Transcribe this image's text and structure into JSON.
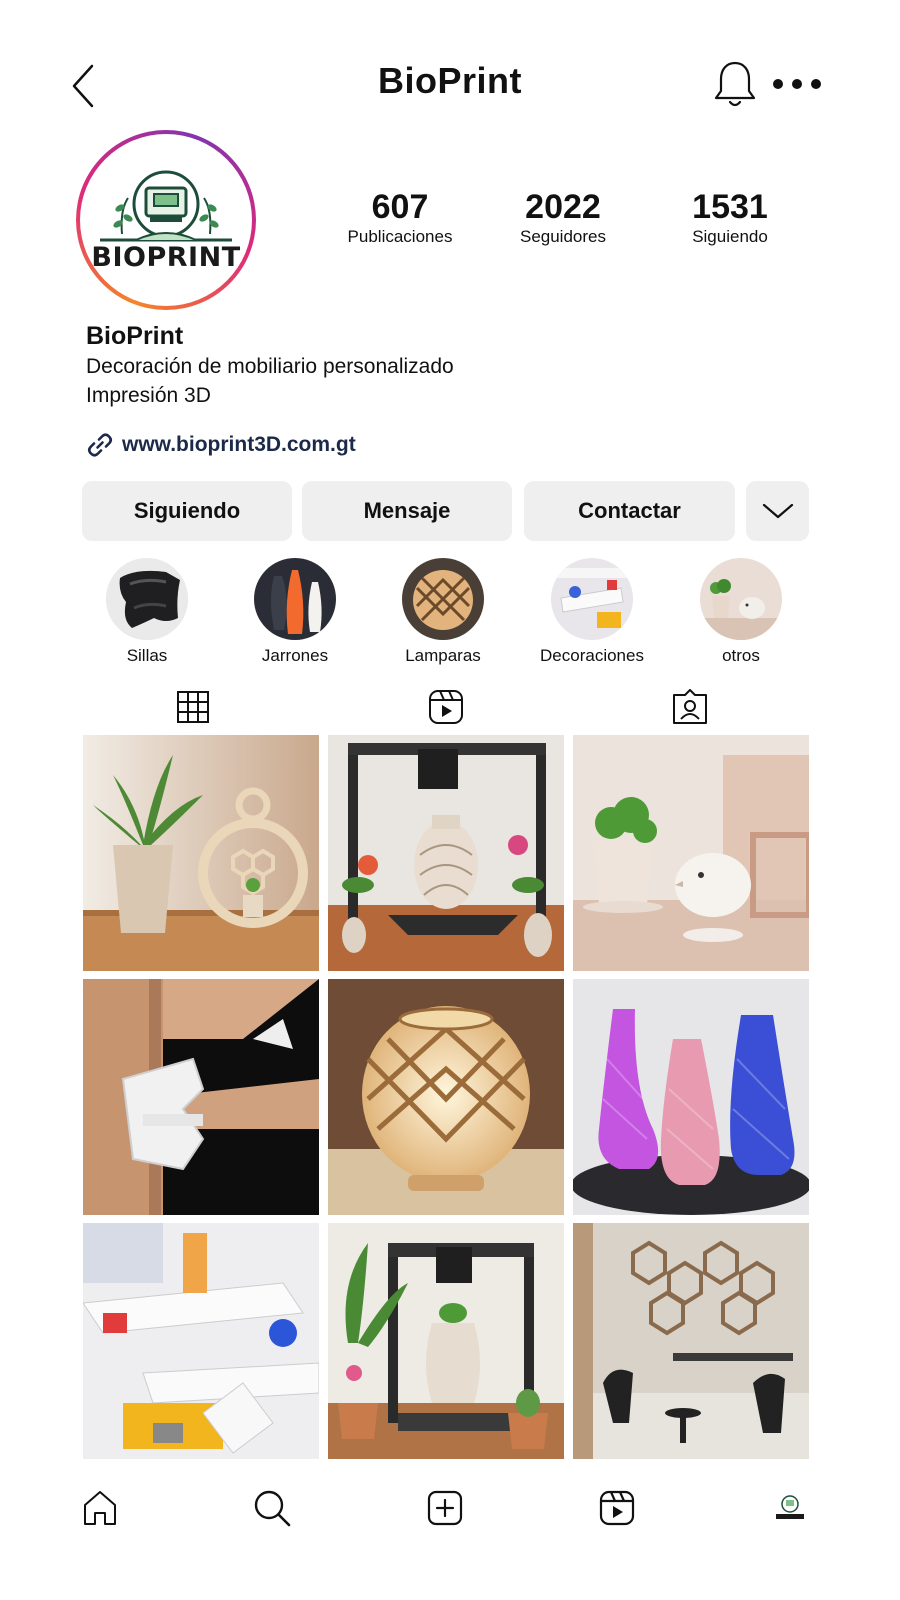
{
  "header": {
    "title": "BioPrint"
  },
  "profile": {
    "avatar_logo_text": "BIOPRINT",
    "stats": [
      {
        "value": "607",
        "label": "Publicaciones"
      },
      {
        "value": "2022",
        "label": "Seguidores"
      },
      {
        "value": "1531",
        "label": "Siguiendo"
      }
    ],
    "name": "BioPrint",
    "bio_lines": [
      "Decoración de mobiliario personalizado",
      "Impresión 3D"
    ],
    "website": "www.bioprint3D.com.gt"
  },
  "actions": {
    "following_label": "Siguiendo",
    "message_label": "Mensaje",
    "contact_label": "Contactar"
  },
  "highlights": [
    {
      "label": "Sillas"
    },
    {
      "label": "Jarrones"
    },
    {
      "label": "Lamparas"
    },
    {
      "label": "Decoraciones"
    },
    {
      "label": "otros"
    }
  ],
  "tabs": [
    "grid-icon",
    "reels-icon",
    "tagged-icon"
  ],
  "posts": [
    "plant-pot-honeycomb-frame",
    "3d-printer-vase",
    "plant-pot-bird",
    "shelf-connector",
    "lattice-lamp",
    "twisted-vases",
    "printed-parts-wall",
    "3d-printer-plants",
    "hexagon-decor-room"
  ],
  "colors": {
    "button_bg": "#efefef",
    "link": "#1b2a48",
    "ring_start": "#f58529",
    "ring_end": "#8134af"
  }
}
